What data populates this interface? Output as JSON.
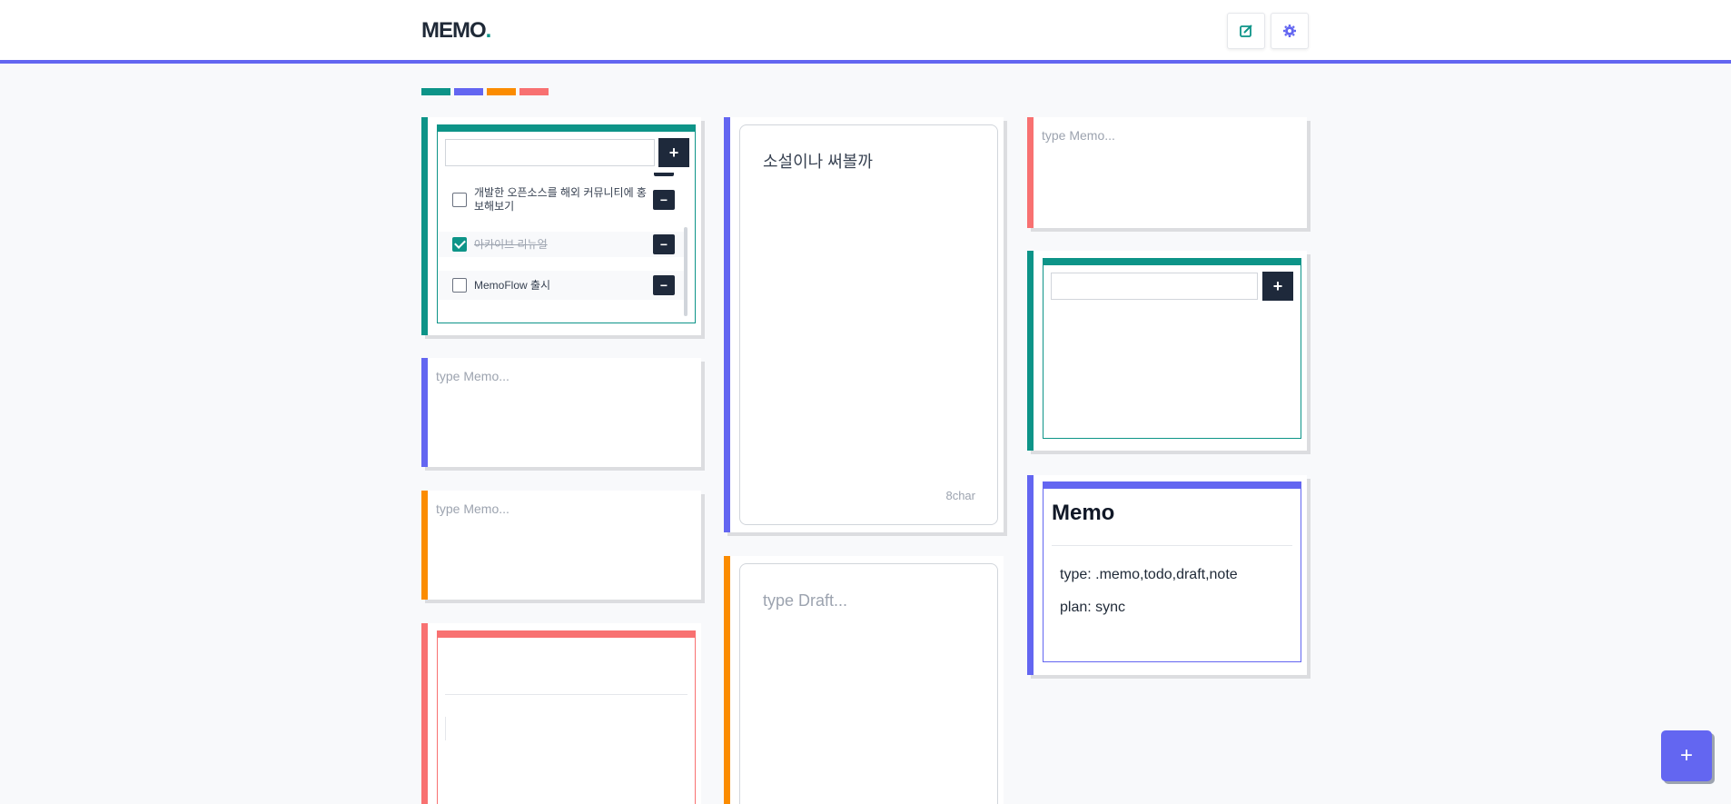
{
  "header": {
    "logo_text": "MEMO",
    "logo_dot": ".",
    "edit_icon": "edit-icon",
    "settings_icon": "gear-icon"
  },
  "colors": {
    "teal": "#0d9488",
    "indigo": "#6366f1",
    "orange": "#fb8c00",
    "red": "#f87171",
    "dark": "#1e293b"
  },
  "swatches": [
    "teal",
    "indigo",
    "orange",
    "red"
  ],
  "todo_card_1": {
    "input_value": "",
    "add_label": "+",
    "items": [
      {
        "text": "개발한 오픈소스를 해외 커뮤니티에 홍보해보기",
        "checked": false,
        "remove_label": "−"
      },
      {
        "text": "아카이브 리뉴얼",
        "checked": true,
        "remove_label": "−"
      },
      {
        "text": "MemoFlow 출시",
        "checked": false,
        "remove_label": "−"
      }
    ]
  },
  "memo_card_1": {
    "placeholder": "type Memo..."
  },
  "memo_card_2": {
    "placeholder": "type Memo..."
  },
  "memo_card_3": {
    "placeholder": "type Memo..."
  },
  "draft_card_1": {
    "text": "소설이나 써볼까",
    "char_count": "8char"
  },
  "draft_card_2": {
    "placeholder": "type Draft..."
  },
  "todo_card_2": {
    "input_value": "",
    "add_label": "+"
  },
  "info_card": {
    "title": "Memo",
    "type_line": "type: .memo,todo,draft,note",
    "plan_line": "plan: sync"
  },
  "fab": {
    "label": "+"
  }
}
